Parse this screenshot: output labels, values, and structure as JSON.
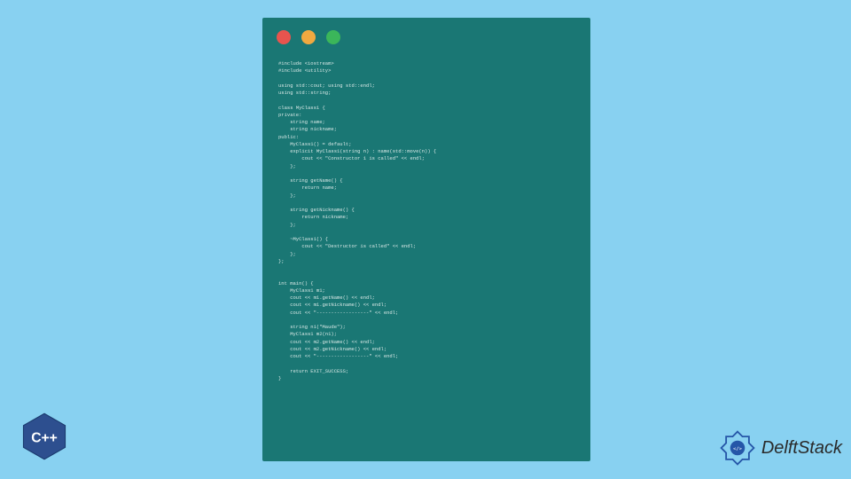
{
  "code": {
    "lines": [
      "#include <iostream>",
      "#include <utility>",
      "",
      "using std::cout; using std::endl;",
      "using std::string;",
      "",
      "class MyClass1 {",
      "private:",
      "    string name;",
      "    string nickname;",
      "public:",
      "    MyClass1() = default;",
      "    explicit MyClass1(string n) : name(std::move(n)) {",
      "        cout << \"Constructor 1 is called\" << endl;",
      "    };",
      "",
      "    string getName() {",
      "        return name;",
      "    };",
      "",
      "    string getNickname() {",
      "        return nickname;",
      "    };",
      "",
      "    ~MyClass1() {",
      "        cout << \"Destructor is called\" << endl;",
      "    };",
      "};",
      "",
      "",
      "int main() {",
      "    MyClass1 m1;",
      "    cout << m1.getName() << endl;",
      "    cout << m1.getNickname() << endl;",
      "    cout << \"------------------\" << endl;",
      "",
      "    string n1(\"Maude\");",
      "    MyClass1 m2(n1);",
      "    cout << m2.getName() << endl;",
      "    cout << m2.getNickname() << endl;",
      "    cout << \"------------------\" << endl;",
      "",
      "    return EXIT_SUCCESS;",
      "}"
    ]
  },
  "logos": {
    "cpp_label": "C++",
    "delft_label": "DelftStack"
  }
}
